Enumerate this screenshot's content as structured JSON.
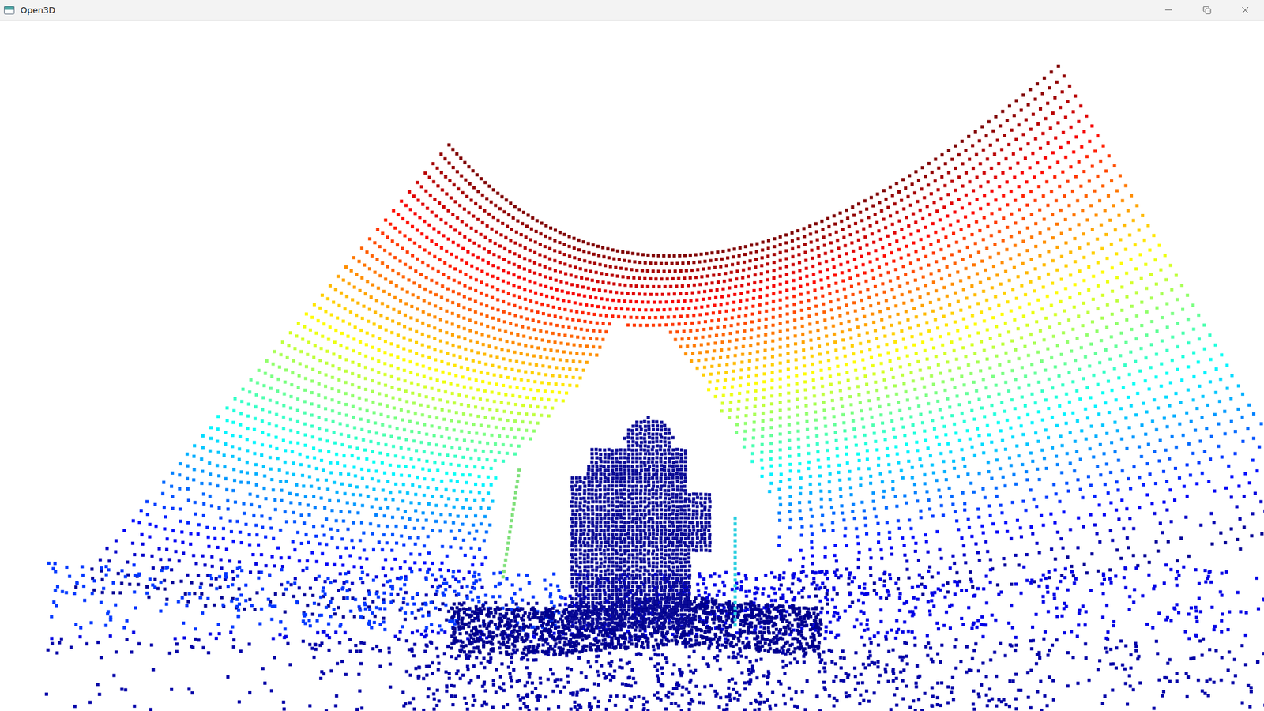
{
  "window": {
    "title": "Open3D"
  }
}
